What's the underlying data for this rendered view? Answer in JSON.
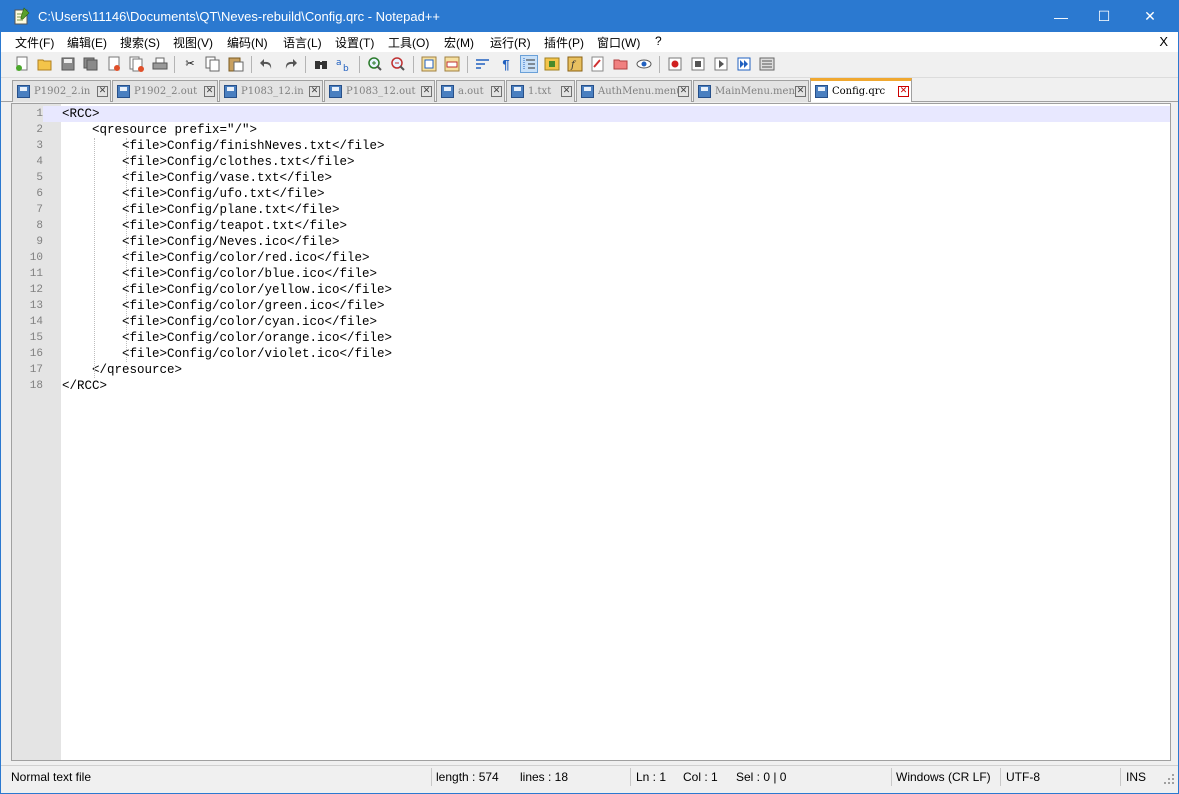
{
  "window": {
    "title": "C:\\Users\\11146\\Documents\\QT\\Neves-rebuild\\Config.qrc - Notepad++",
    "minimize_glyph": "—",
    "maximize_glyph": "☐",
    "close_glyph": "✕",
    "title_bar_color": "#2b79d0"
  },
  "menu": {
    "items": [
      "文件(F)",
      "编辑(E)",
      "搜索(S)",
      "视图(V)",
      "编码(N)",
      "语言(L)",
      "设置(T)",
      "工具(O)",
      "宏(M)",
      "运行(R)",
      "插件(P)",
      "窗口(W)",
      "?"
    ],
    "close_label": "X"
  },
  "toolbar": {
    "icons": [
      "new-file-icon",
      "open-file-icon",
      "save-icon",
      "save-all-icon",
      "close-icon",
      "close-all-icon",
      "print-icon",
      "cut-icon",
      "copy-icon",
      "paste-icon",
      "undo-icon",
      "redo-icon",
      "find-icon",
      "replace-icon",
      "zoom-in-icon",
      "zoom-out-icon",
      "sync-vertical-icon",
      "sync-horizontal-icon",
      "word-wrap-icon",
      "show-all-chars-icon",
      "indent-guide-icon",
      "doc-map-icon",
      "function-list-icon",
      "folder-as-workspace-icon",
      "doc-switcher-icon",
      "monitoring-icon",
      "record-macro-icon",
      "stop-macro-icon",
      "play-macro-icon",
      "run-macro-multiple-icon",
      "save-macro-icon"
    ]
  },
  "tabs": [
    {
      "label": "P1902_2.in",
      "active": false
    },
    {
      "label": "P1902_2.out",
      "active": false
    },
    {
      "label": "P1083_12.in",
      "active": false
    },
    {
      "label": "P1083_12.out",
      "active": false
    },
    {
      "label": "a.out",
      "active": false
    },
    {
      "label": "1.txt",
      "active": false
    },
    {
      "label": "AuthMenu.menu",
      "active": false
    },
    {
      "label": "MainMenu.menu",
      "active": false
    },
    {
      "label": "Config.qrc",
      "active": true
    }
  ],
  "editor": {
    "lines": [
      {
        "n": "1",
        "text": "<RCC>"
      },
      {
        "n": "2",
        "text": "    <qresource prefix=\"/\">"
      },
      {
        "n": "3",
        "text": "        <file>Config/finishNeves.txt</file>"
      },
      {
        "n": "4",
        "text": "        <file>Config/clothes.txt</file>"
      },
      {
        "n": "5",
        "text": "        <file>Config/vase.txt</file>"
      },
      {
        "n": "6",
        "text": "        <file>Config/ufo.txt</file>"
      },
      {
        "n": "7",
        "text": "        <file>Config/plane.txt</file>"
      },
      {
        "n": "8",
        "text": "        <file>Config/teapot.txt</file>"
      },
      {
        "n": "9",
        "text": "        <file>Config/Neves.ico</file>"
      },
      {
        "n": "10",
        "text": "        <file>Config/color/red.ico</file>"
      },
      {
        "n": "11",
        "text": "        <file>Config/color/blue.ico</file>"
      },
      {
        "n": "12",
        "text": "        <file>Config/color/yellow.ico</file>"
      },
      {
        "n": "13",
        "text": "        <file>Config/color/green.ico</file>"
      },
      {
        "n": "14",
        "text": "        <file>Config/color/cyan.ico</file>"
      },
      {
        "n": "15",
        "text": "        <file>Config/color/orange.ico</file>"
      },
      {
        "n": "16",
        "text": "        <file>Config/color/violet.ico</file>"
      },
      {
        "n": "17",
        "text": "    </qresource>"
      },
      {
        "n": "18",
        "text": "</RCC>"
      }
    ],
    "current_line": 1
  },
  "status": {
    "file_type": "Normal text file",
    "length": "length : 574",
    "lines": "lines : 18",
    "ln": "Ln : 1",
    "col": "Col : 1",
    "sel": "Sel : 0 | 0",
    "eol": "Windows (CR LF)",
    "encoding": "UTF-8",
    "mode": "INS"
  }
}
